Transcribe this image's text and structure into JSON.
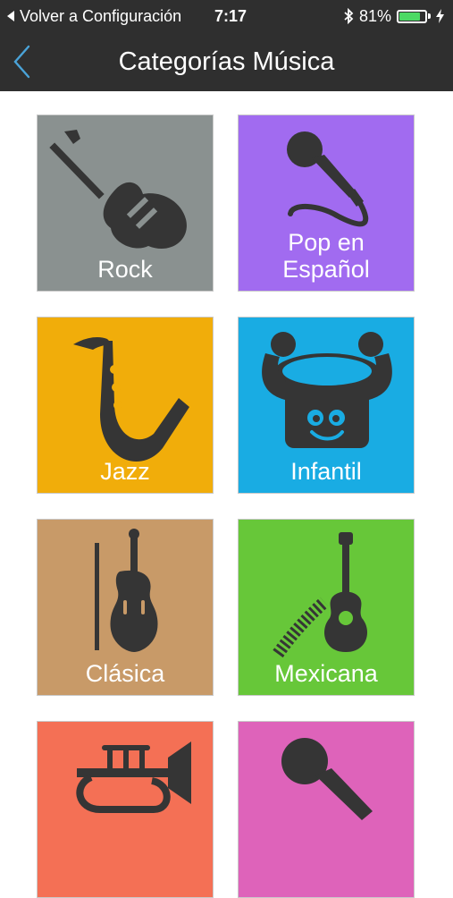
{
  "status_bar": {
    "back_label": "Volver a Configuración",
    "time": "7:17",
    "bluetooth_icon": "bluetooth-icon",
    "battery_percent": "81%",
    "battery_level": 0.81,
    "charging_icon": "bolt-icon"
  },
  "nav": {
    "back_icon": "chevron-left-icon",
    "title": "Categorías Música"
  },
  "colors": {
    "bar_bg": "#2f2f2f",
    "back_accent": "#4aa3d8",
    "icon_dark": "#353535"
  },
  "categories": [
    {
      "label_lines": [
        "Rock"
      ],
      "color": "#8a9190",
      "icon": "electric-guitar-icon"
    },
    {
      "label_lines": [
        "Pop en",
        "Español"
      ],
      "color": "#a16bf0",
      "icon": "microphone-icon"
    },
    {
      "label_lines": [
        "Jazz"
      ],
      "color": "#f1ad0a",
      "icon": "saxophone-icon"
    },
    {
      "label_lines": [
        "Infantil"
      ],
      "color": "#19ace3",
      "icon": "drum-character-icon"
    },
    {
      "label_lines": [
        "Clásica"
      ],
      "color": "#c89a68",
      "icon": "violin-icon"
    },
    {
      "label_lines": [
        "Mexicana"
      ],
      "color": "#67c739",
      "icon": "acoustic-guitar-serape-icon"
    },
    {
      "label_lines": [
        ""
      ],
      "color": "#f47055",
      "icon": "trumpet-icon"
    },
    {
      "label_lines": [
        ""
      ],
      "color": "#de63ba",
      "icon": "microphone-icon"
    }
  ]
}
